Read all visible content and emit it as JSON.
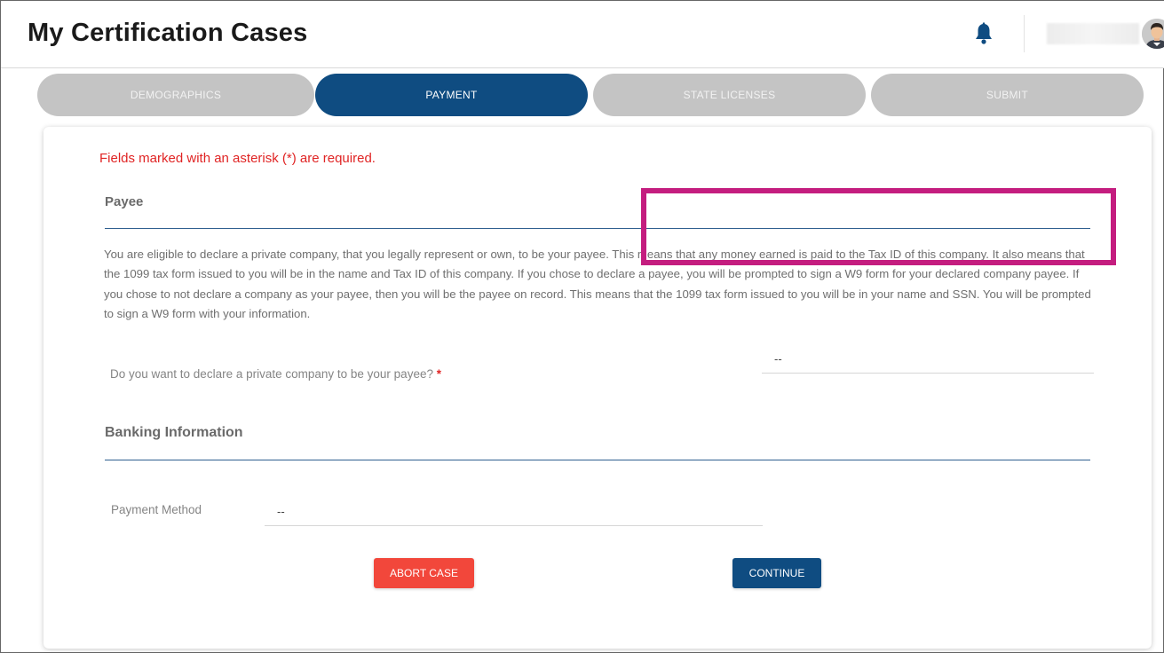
{
  "header": {
    "title": "My Certification Cases",
    "bell_icon": "bell-icon",
    "avatar_icon": "user-avatar"
  },
  "steps": [
    {
      "label": "DEMOGRAPHICS",
      "active": false
    },
    {
      "label": "PAYMENT",
      "active": true
    },
    {
      "label": "STATE LICENSES",
      "active": false
    },
    {
      "label": "SUBMIT",
      "active": false
    }
  ],
  "form": {
    "required_note": "Fields marked with an asterisk (*) are required.",
    "payee": {
      "title": "Payee",
      "description": "You are eligible to declare a private company, that you legally represent or own, to be your payee. This means that any money earned is paid to the Tax ID of this company. It also means that the 1099 tax form issued to you will be in the name and Tax ID of this company. If you chose to declare a payee, you will be prompted to sign a W9 form for your declared company payee. If you chose to not declare a company as your payee, then you will be the payee on record. This means that the 1099 tax form issued to you will be in your name and SSN. You will be prompted to sign a W9 form with your information.",
      "question_label": "Do you want to declare a private company to be your payee?",
      "required_star": "*",
      "question_value": "--"
    },
    "banking": {
      "title": "Banking Information",
      "payment_method_label": "Payment Method",
      "payment_method_value": "--"
    },
    "buttons": {
      "abort": "ABORT CASE",
      "continue": "CONTINUE"
    }
  },
  "colors": {
    "primary": "#0f4c81",
    "inactive_step": "#c4c4c4",
    "required": "#e02424",
    "abort": "#f2473b",
    "highlight": "#c41d7f"
  }
}
